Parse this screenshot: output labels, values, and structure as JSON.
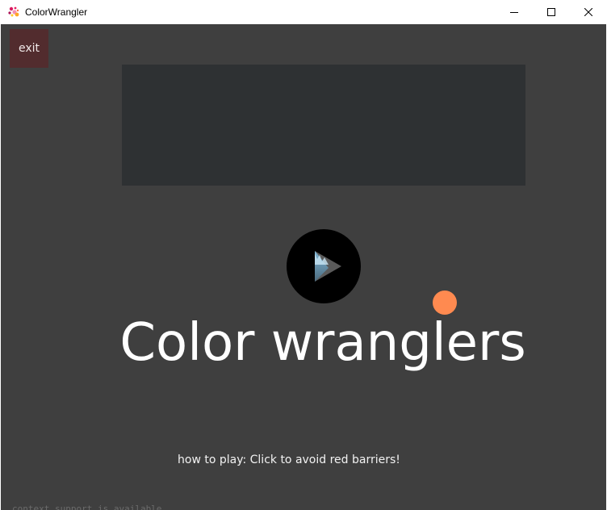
{
  "window": {
    "title": "ColorWrangler",
    "icon": "app-splash-icon",
    "controls": {
      "minimize_icon": "minimize-icon",
      "maximize_icon": "maximize-icon",
      "close_icon": "close-icon"
    }
  },
  "game": {
    "exit_label": "exit",
    "title": "Color wranglers",
    "instructions": "how to play: Click to avoid red barriers!",
    "console_line": "context support is available",
    "play_icon": "play-icon",
    "colors": {
      "background": "#3f3f3f",
      "panel": "#2e3133",
      "exit_button": "#522c2e",
      "orange_dot": "#ff8a50",
      "play_button": "#000000"
    }
  }
}
